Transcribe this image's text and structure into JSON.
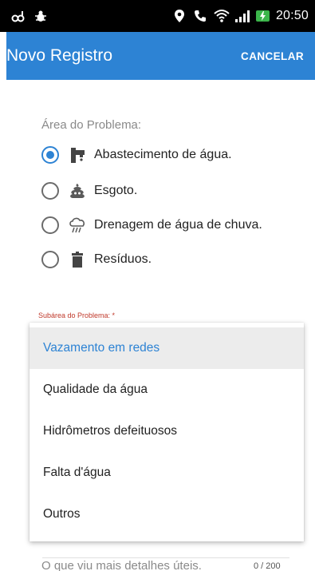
{
  "status_bar": {
    "time": "20:50",
    "icons": [
      "link-icon",
      "bug-icon",
      "location-icon",
      "phone-icon",
      "wifi-icon",
      "signal-icon",
      "battery-charging-icon"
    ]
  },
  "app_bar": {
    "title": "Novo Registro",
    "cancel_label": "CANCELAR",
    "color": "#2d83d4"
  },
  "form": {
    "area_label": "Área do Problema:",
    "area_options": [
      {
        "label": "Abastecimento de água.",
        "icon": "water-tap-icon",
        "checked": true
      },
      {
        "label": "Esgoto.",
        "icon": "sewage-icon",
        "checked": false
      },
      {
        "label": "Drenagem de água de chuva.",
        "icon": "rain-cloud-icon",
        "checked": false
      },
      {
        "label": "Resíduos.",
        "icon": "trash-icon",
        "checked": false
      }
    ],
    "subarea_label": "Subárea do Problema: *",
    "subarea_options": [
      "Vazamento em redes",
      "Qualidade da água",
      "Hidrômetros defeituosos",
      "Falta d'água",
      "Outros"
    ],
    "subarea_selected": "Vazamento em redes",
    "description_placeholder": "O que viu mais detalhes úteis.",
    "description_counter": "0 / 200"
  }
}
